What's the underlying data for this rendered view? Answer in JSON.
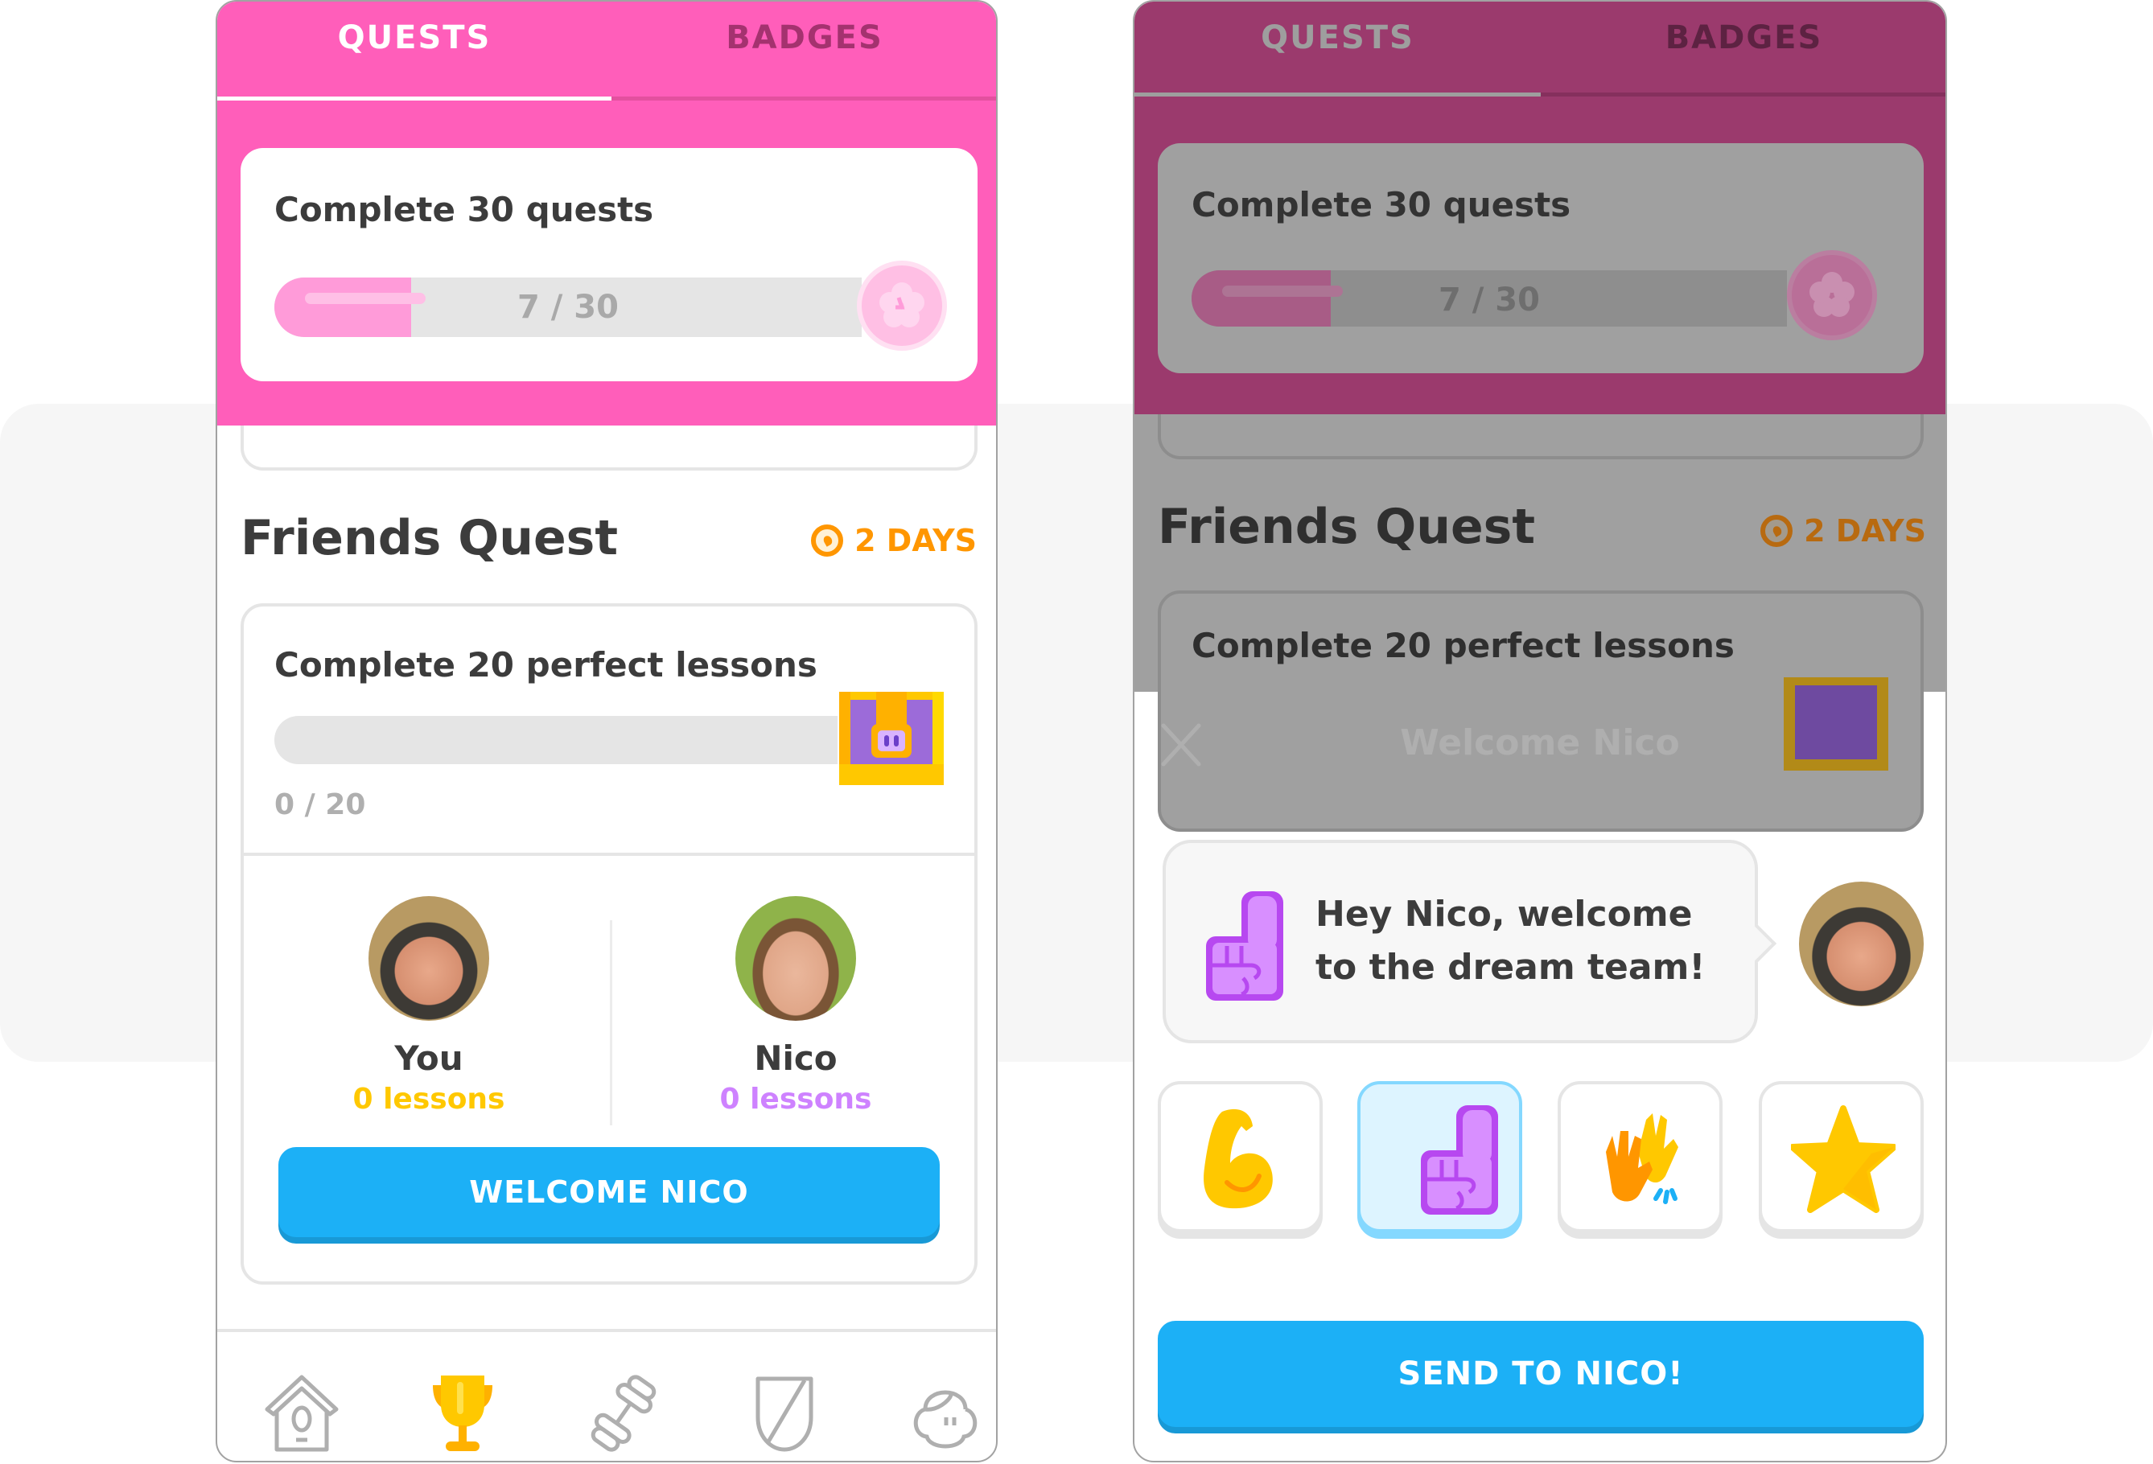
{
  "left_screen": {
    "tabs": [
      {
        "label": "QUESTS",
        "active": true
      },
      {
        "label": "BADGES",
        "active": false
      }
    ],
    "monthly_quest": {
      "title": "Complete 30 quests",
      "progress_text": "7 / 30",
      "progress_value": 7,
      "progress_max": 30
    },
    "friends_quest": {
      "heading": "Friends Quest",
      "time_left": "2 DAYS",
      "task": "Complete 20 perfect lessons",
      "progress_text": "0 / 20",
      "progress_value": 0,
      "progress_max": 20,
      "members": [
        {
          "name": "You",
          "lessons": "0 lessons",
          "color": "#ffc800"
        },
        {
          "name": "Nico",
          "lessons": "0 lessons",
          "color": "#ce82ff"
        }
      ],
      "action_button": "WELCOME NICO"
    },
    "nav": [
      {
        "icon": "home-icon",
        "label": "Home",
        "active": false
      },
      {
        "icon": "trophy-icon",
        "label": "Quests",
        "active": true
      },
      {
        "icon": "dumbbell-icon",
        "label": "Practice",
        "active": false
      },
      {
        "icon": "shield-icon",
        "label": "Leagues",
        "active": false
      },
      {
        "icon": "profile-icon",
        "label": "Profile",
        "active": false
      }
    ]
  },
  "right_screen": {
    "tabs": [
      {
        "label": "QUESTS",
        "active": true
      },
      {
        "label": "BADGES",
        "active": false
      }
    ],
    "monthly_quest": {
      "title": "Complete 30 quests",
      "progress_text": "7 / 30",
      "progress_value": 7,
      "progress_max": 30
    },
    "friends_quest": {
      "heading": "Friends Quest",
      "time_left": "2 DAYS",
      "task": "Complete 20 perfect lessons"
    },
    "sheet": {
      "title": "Welcome Nico",
      "message": "Hey Nico, welcome to the dream team!",
      "reactions": [
        {
          "icon": "flexed-bicep-icon",
          "selected": false
        },
        {
          "icon": "foam-finger-icon",
          "selected": true
        },
        {
          "icon": "high-five-icon",
          "selected": false
        },
        {
          "icon": "star-icon",
          "selected": false
        }
      ],
      "send_button": "SEND TO NICO!"
    }
  },
  "colors": {
    "quest_pink": "#ff5eba",
    "primary_blue": "#1cb0f6",
    "timer_orange": "#ff9600",
    "you_yellow": "#ffc800",
    "friend_purple": "#ce82ff"
  }
}
